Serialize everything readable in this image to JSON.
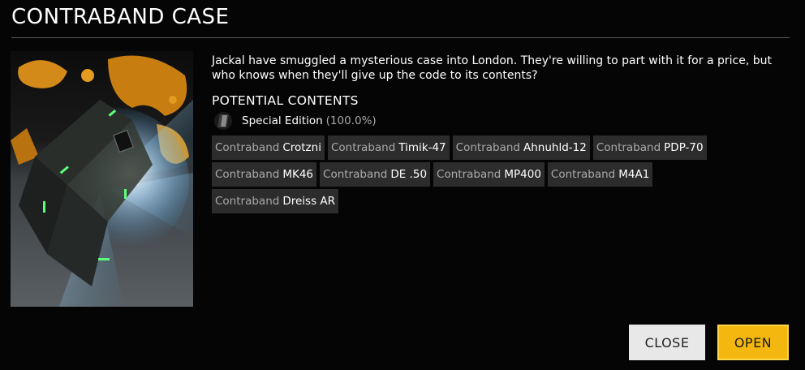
{
  "dialog": {
    "title": "CONTRABAND CASE",
    "description": "Jackal have smuggled a mysterious case into London. They're willing to part with it for a price, but who knows when they'll give up the code to its contents?",
    "contents_heading": "POTENTIAL CONTENTS"
  },
  "special": {
    "name": "Special Edition",
    "chance": "(100.0%)",
    "icon": "case-icon"
  },
  "items": [
    {
      "prefix": "Contraband",
      "name": "Crotzni"
    },
    {
      "prefix": "Contraband",
      "name": "Timik-47"
    },
    {
      "prefix": "Contraband",
      "name": "Ahnuhld-12"
    },
    {
      "prefix": "Contraband",
      "name": "PDP-70"
    },
    {
      "prefix": "Contraband",
      "name": "MK46"
    },
    {
      "prefix": "Contraband",
      "name": "DE .50"
    },
    {
      "prefix": "Contraband",
      "name": "MP400"
    },
    {
      "prefix": "Contraband",
      "name": "M4A1"
    },
    {
      "prefix": "Contraband",
      "name": "Dreiss AR"
    }
  ],
  "buttons": {
    "close_label": "CLOSE",
    "open_label": "OPEN"
  },
  "colors": {
    "background": "#050505",
    "chip": "#2c2c2c",
    "open_accent": "#f3b70f",
    "close_bg": "#e8e8e8",
    "case_glow": "#5cff7a"
  }
}
